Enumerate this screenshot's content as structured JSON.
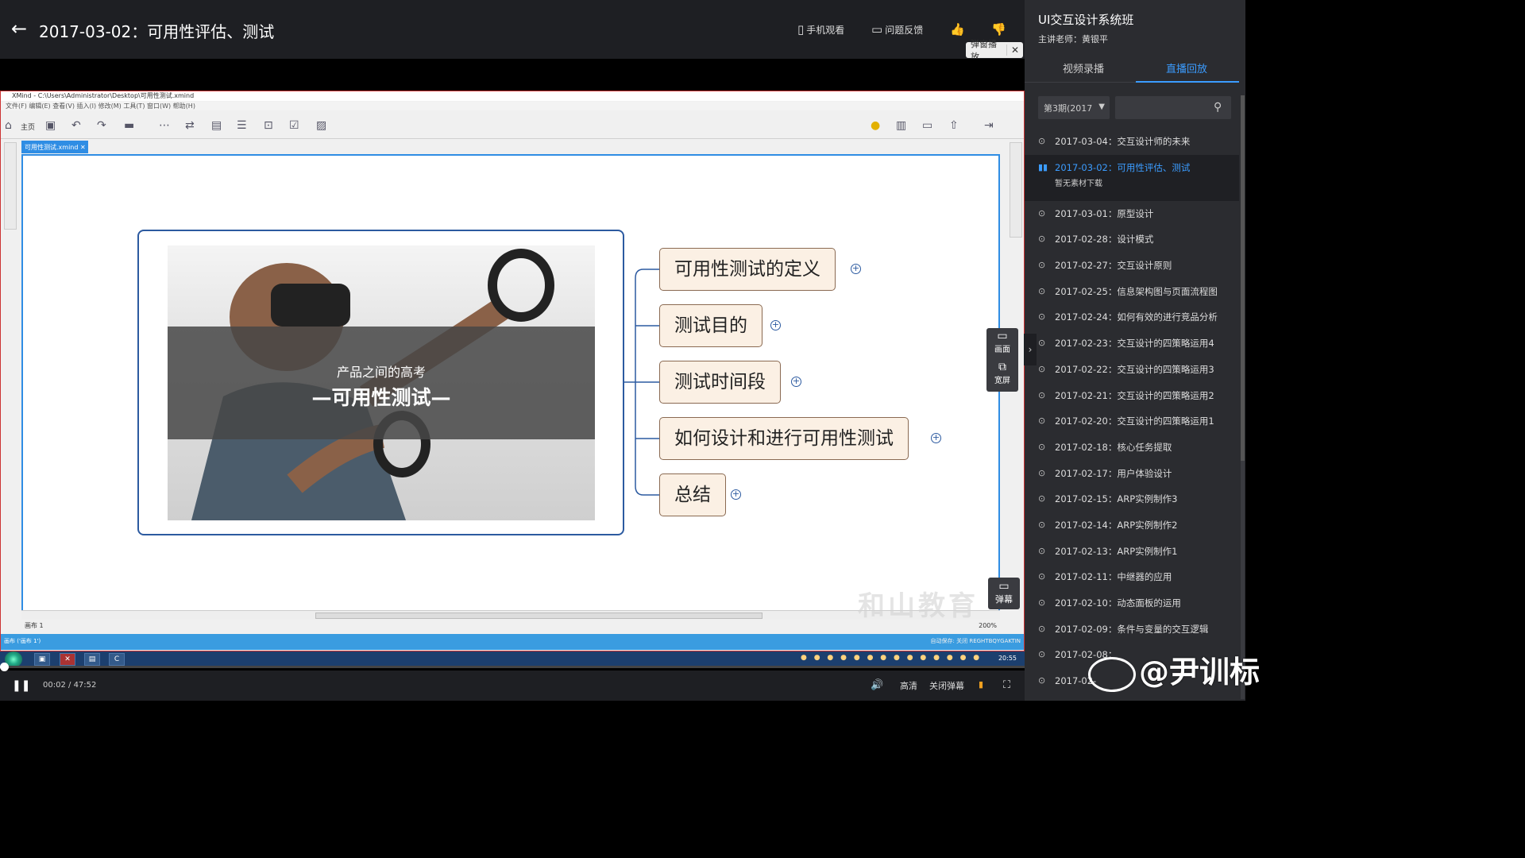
{
  "header": {
    "title": "2017-03-02：可用性评估、测试",
    "mobile": "手机观看",
    "feedback": "问题反馈",
    "popup_tip": "弹窗播放",
    "close": "✕"
  },
  "sidebar": {
    "course_title": "UI交互设计系统班",
    "teacher": "主讲老师：黄银平",
    "tabs": [
      {
        "label": "视频录播"
      },
      {
        "label": "直播回放"
      }
    ],
    "session_select": "第3期(2017",
    "search_placeholder": "",
    "items": [
      {
        "label": "2017-03-04：交互设计师的未来"
      },
      {
        "label": "2017-03-02：可用性评估、测试",
        "sub": "暂无素材下载"
      },
      {
        "label": "2017-03-01：原型设计"
      },
      {
        "label": "2017-02-28：设计模式"
      },
      {
        "label": "2017-02-27：交互设计原则"
      },
      {
        "label": "2017-02-25：信息架构图与页面流程图"
      },
      {
        "label": "2017-02-24：如何有效的进行竞品分析"
      },
      {
        "label": "2017-02-23：交互设计的四策略运用4"
      },
      {
        "label": "2017-02-22：交互设计的四策略运用3"
      },
      {
        "label": "2017-02-21：交互设计的四策略运用2"
      },
      {
        "label": "2017-02-20：交互设计的四策略运用1"
      },
      {
        "label": "2017-02-18：核心任务提取"
      },
      {
        "label": "2017-02-17：用户体验设计"
      },
      {
        "label": "2017-02-15：ARP实例制作3"
      },
      {
        "label": "2017-02-14：ARP实例制作2"
      },
      {
        "label": "2017-02-13：ARP实例制作1"
      },
      {
        "label": "2017-02-11：中继器的应用"
      },
      {
        "label": "2017-02-10：动态面板的运用"
      },
      {
        "label": "2017-02-09：条件与变量的交互逻辑"
      },
      {
        "label": "2017-02-08："
      },
      {
        "label": "2017-02-"
      }
    ]
  },
  "xmind": {
    "window_title": "XMind - C:\\Users\\Administrator\\Desktop\\可用性测试.xmind",
    "menu": "文件(F)   编辑(E)   查看(V)   插入(I)   修改(M)   工具(T)   窗口(W)   帮助(H)",
    "home": "主页",
    "doc_tab": "可用性测试.xmind",
    "sheet": "画布 1",
    "status": "画布 ('画布 1')",
    "zoom": "200%",
    "autosave": "自动保存: 关闭   REGHTBQYGAKTIN",
    "clock": "20:55",
    "central": {
      "subtitle": "产品之间的高考",
      "title": "—可用性测试—"
    },
    "topics": [
      "可用性测试的定义",
      "测试目的",
      "测试时间段",
      "如何设计和进行可用性测试",
      "总结"
    ],
    "watermark": "和山教育"
  },
  "player": {
    "current": "00:02",
    "total": "47:52",
    "progress": 0.0007,
    "quality": "高清",
    "danmu_close": "关闭弹幕",
    "screen_label": "画面",
    "wide_label": "宽屏",
    "danmu_label": "弹幕"
  },
  "weibo": "@尹训标",
  "colors": {
    "accent": "#3b9cff",
    "topic_fill": "#fbf0e4",
    "topic_border": "#8a6a52",
    "frame": "#2c5aa0"
  }
}
